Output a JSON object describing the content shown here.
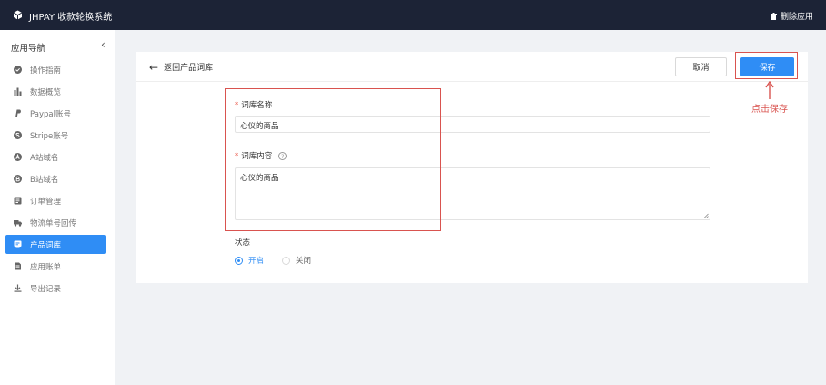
{
  "topbar": {
    "title": "JHPAY 收款轮换系统",
    "delete_label": "删除应用"
  },
  "sidebar": {
    "heading": "应用导航",
    "collapse_icon": "‹",
    "items": [
      {
        "label": "操作指南",
        "icon": "circle-check-icon"
      },
      {
        "label": "数据概览",
        "icon": "bar-chart-icon"
      },
      {
        "label": "Paypal账号",
        "icon": "paypal-icon"
      },
      {
        "label": "Stripe账号",
        "icon": "stripe-icon"
      },
      {
        "label": "A站域名",
        "icon": "a-circle-icon"
      },
      {
        "label": "B站域名",
        "icon": "b-circle-icon"
      },
      {
        "label": "订单管理",
        "icon": "order-icon"
      },
      {
        "label": "物流单号回传",
        "icon": "truck-icon"
      },
      {
        "label": "产品词库",
        "icon": "product-icon",
        "active": true
      },
      {
        "label": "应用账单",
        "icon": "bill-icon"
      },
      {
        "label": "导出记录",
        "icon": "download-icon"
      }
    ]
  },
  "header": {
    "back_label": "返回产品词库",
    "cancel_label": "取消",
    "save_label": "保存"
  },
  "form": {
    "name_label": "词库名称",
    "name_value": "心仪的商品",
    "content_label": "词库内容",
    "content_value": "心仪的商品",
    "help_glyph": "?",
    "status_label": "状态",
    "status_options": [
      {
        "label": "开启",
        "selected": true
      },
      {
        "label": "关闭",
        "selected": false
      }
    ]
  },
  "annotation": {
    "text": "点击保存",
    "color": "#d9534f"
  },
  "colors": {
    "topbar": "#1c2336",
    "accent": "#2f8df5",
    "annotation": "#d9534f"
  }
}
